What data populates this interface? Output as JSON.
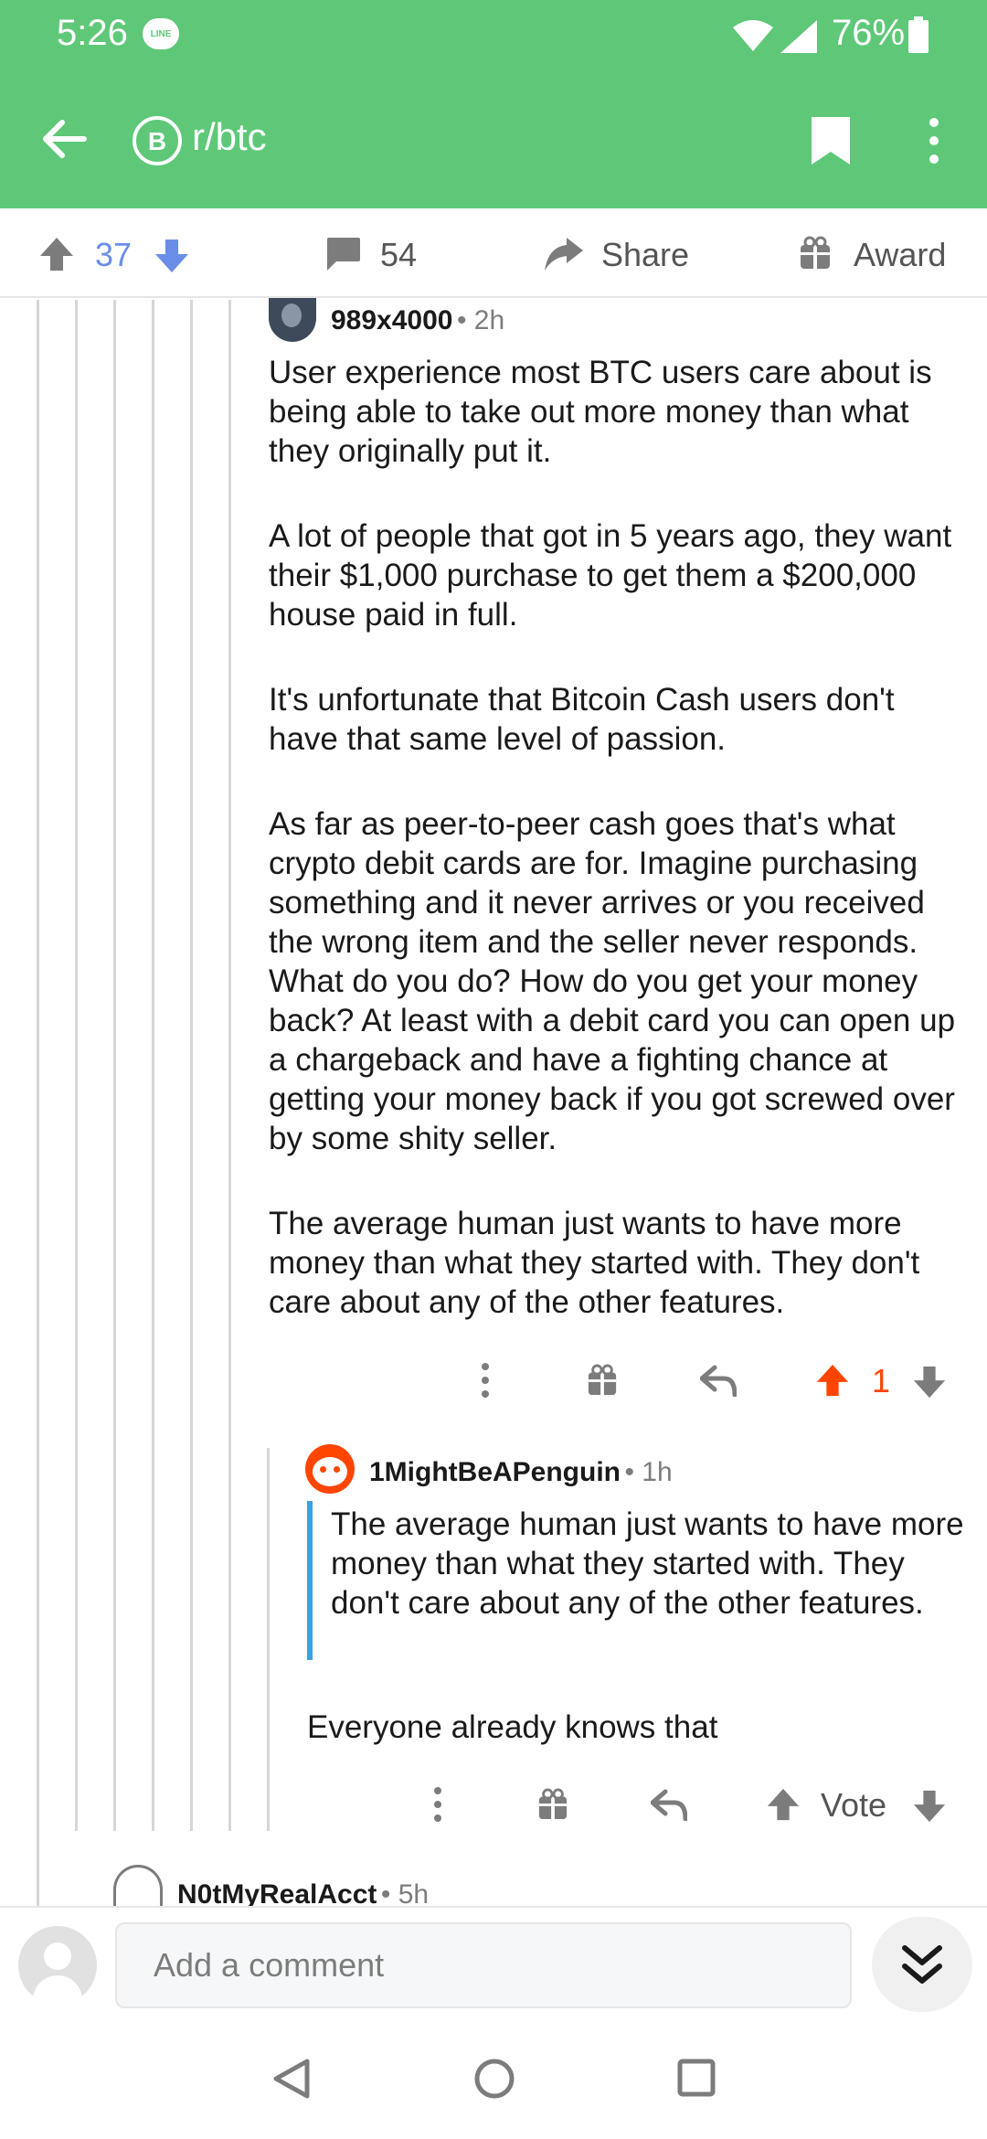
{
  "status_bar": {
    "time": "5:26",
    "notification_badge": "LINE",
    "battery": "76%"
  },
  "header": {
    "subreddit": "r/btc",
    "icons": [
      "back-arrow-icon",
      "bitcoin-icon",
      "bookmark-icon",
      "more-vert-icon"
    ]
  },
  "action_bar": {
    "score": "37",
    "comments_count": "54",
    "share_label": "Share",
    "award_label": "Award"
  },
  "comments": [
    {
      "username": "989x4000",
      "age": "2h",
      "paragraphs": [
        "User experience most BTC users care about is being able to take out more money than what they originally put it.",
        "A lot of people that got in 5 years ago, they want their $1,000 purchase to get them a $200,000 house paid in full.",
        "It's unfortunate that Bitcoin Cash users don't have that same level of passion.",
        "As far as peer-to-peer cash goes that's what crypto debit cards are for. Imagine purchasing something and it never arrives or you received the wrong item and the seller never responds. What do you do? How do you get your money back? At least with a debit card you can open up a chargeback and have a fighting chance at getting your money back if you got screwed over by some shity seller.",
        "The average human just wants to have more money than what they started with. They don't care about any of the other features."
      ],
      "vote_count": "1",
      "vote_color": "#ff4500"
    },
    {
      "username": "1MightBeAPenguin",
      "age": "1h",
      "quote": "The average human just wants to have more money than what they started with. They don't care about any of the other features.",
      "text": "Everyone already knows that",
      "vote_label": "Vote"
    },
    {
      "username": "N0tMyRealAcct",
      "age": "5h"
    }
  ],
  "bottom": {
    "comment_placeholder": "Add a comment"
  },
  "colors": {
    "header_green": "#5ec878",
    "upvote_orange": "#ff4500",
    "score_blue": "#6a8ee8",
    "quote_bar": "#3aa0e8"
  }
}
